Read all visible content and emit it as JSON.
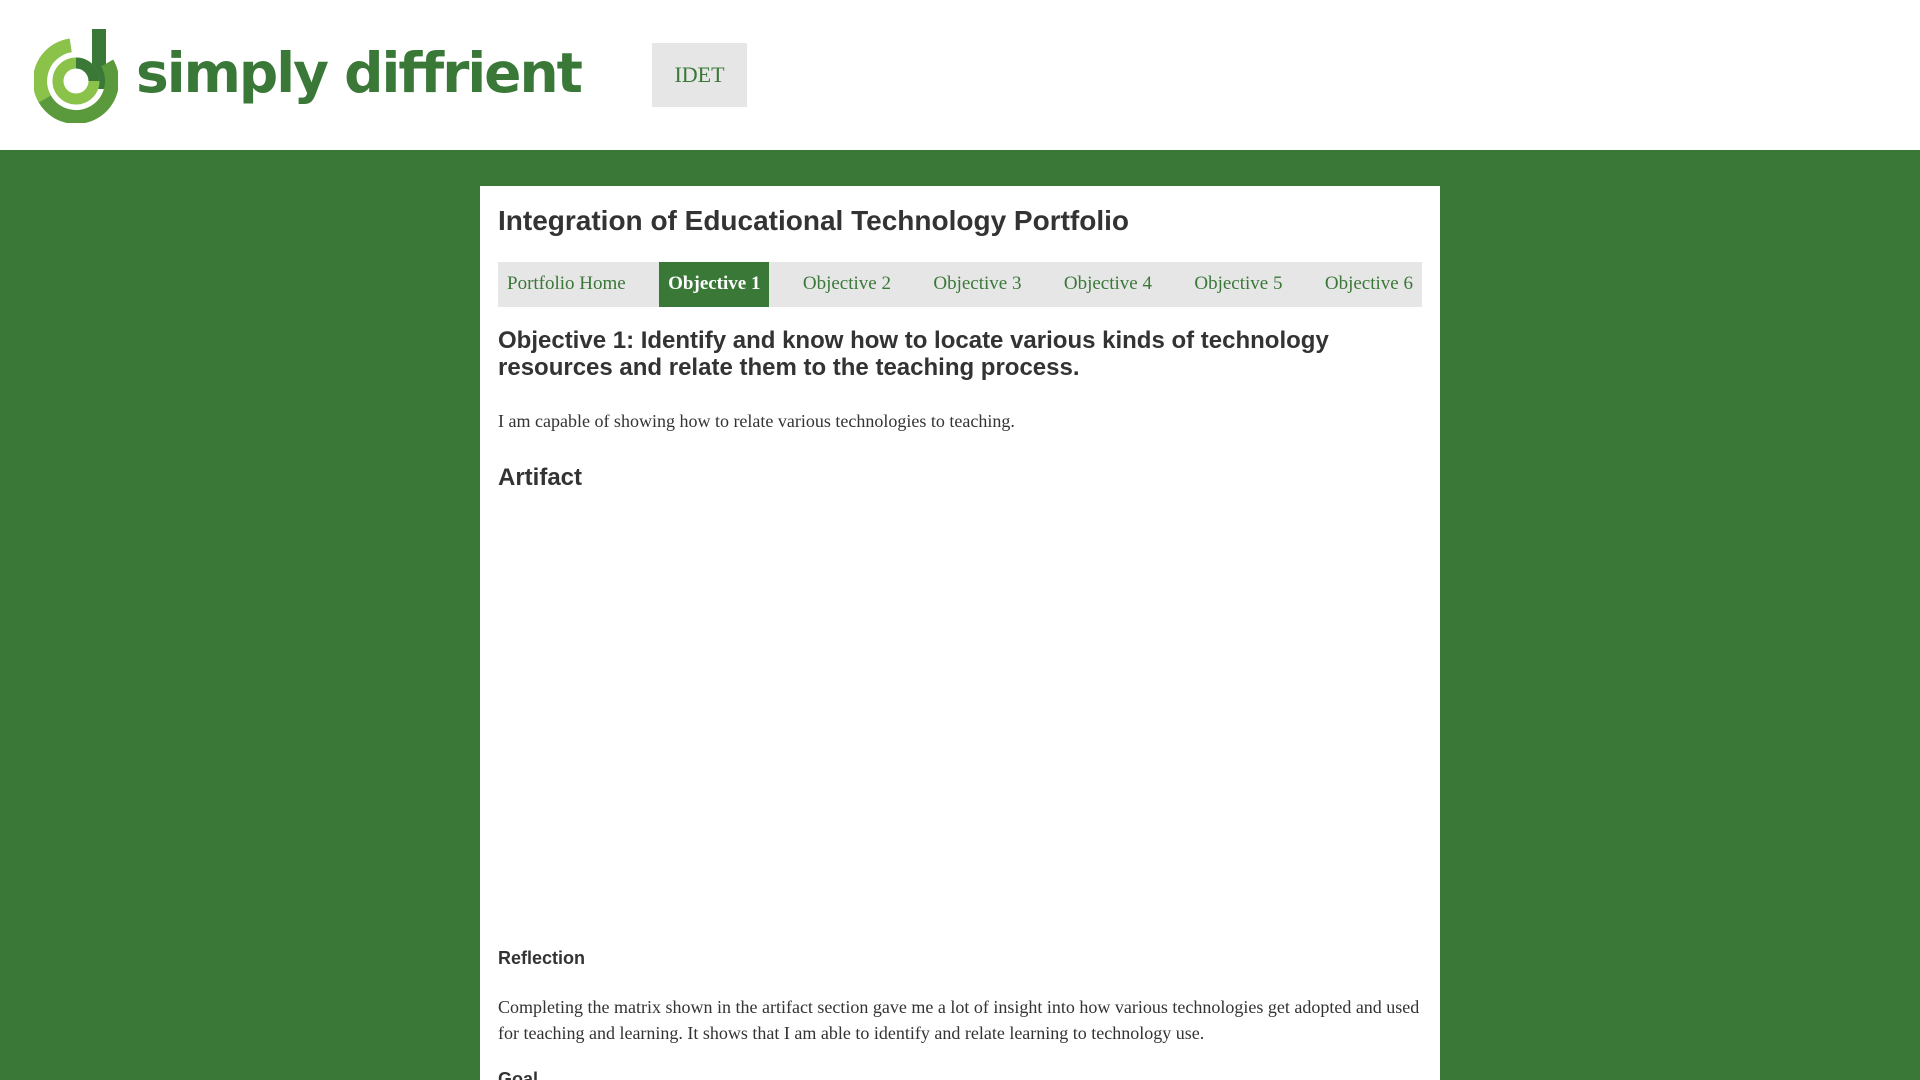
{
  "header": {
    "brand_name": "simply diffrient",
    "nav_button": "IDET"
  },
  "colors": {
    "brand_green": "#3a7838",
    "light_green": "#8bc34a",
    "nav_gray": "#e6e6e6",
    "text": "#333333"
  },
  "page": {
    "title": "Integration of Educational Technology Portfolio",
    "tabs": [
      {
        "label": "Portfolio Home",
        "active": false
      },
      {
        "label": "Objective 1",
        "active": true
      },
      {
        "label": "Objective 2",
        "active": false
      },
      {
        "label": "Objective 3",
        "active": false
      },
      {
        "label": "Objective 4",
        "active": false
      },
      {
        "label": "Objective 5",
        "active": false
      },
      {
        "label": "Objective 6",
        "active": false
      }
    ],
    "objective_title": "Objective 1: Identify and know how to locate various kinds of technology resources and relate them to the teaching process.",
    "statement": "I am capable of showing how to relate various technologies to teaching.",
    "artifact_heading": "Artifact",
    "reflection_heading": "Reflection",
    "reflection_text": "Completing the matrix shown in the artifact section gave me a lot of insight into how various technologies get adopted and used for teaching and learning. It shows that I am able to identify and relate learning to technology use.",
    "goal_heading": "Goal"
  }
}
